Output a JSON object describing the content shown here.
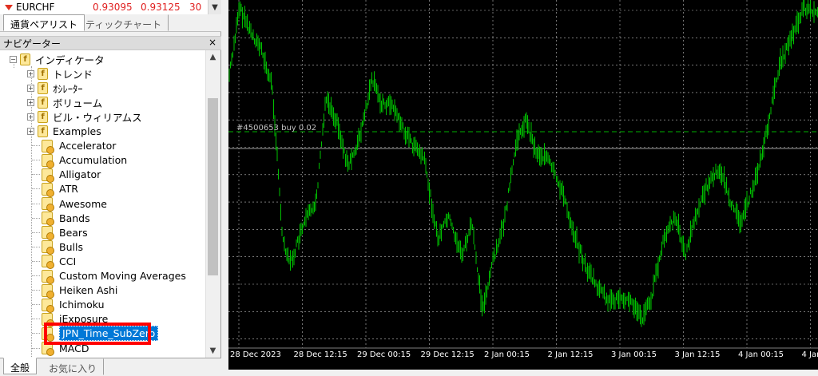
{
  "market_watch": {
    "symbol": "EURCHF",
    "bid": "0.93095",
    "ask": "0.93125",
    "spread": "30"
  },
  "top_tabs": [
    "通貨ペアリスト",
    "ティックチャート"
  ],
  "navigator": {
    "title": "ナビゲーター",
    "close_symbol": "×",
    "root": "インディケータ",
    "folders": [
      "トレンド",
      "ｵｼﾚｰﾀｰ",
      "ボリューム",
      "ビル・ウィリアムス",
      "Examples"
    ],
    "items": [
      "Accelerator",
      "Accumulation",
      "Alligator",
      "ATR",
      "Awesome",
      "Bands",
      "Bears",
      "Bulls",
      "CCI",
      "Custom Moving Averages",
      "Heiken Ashi",
      "Ichimoku",
      "iExposure",
      "JPN_Time_SubZero",
      "MACD"
    ],
    "selected_item": "JPN_Time_SubZero"
  },
  "bottom_tabs": [
    "全般",
    "お気に入り"
  ],
  "chart": {
    "order_label": "#4500653 buy 0.02",
    "time_labels": [
      "28 Dec 2023",
      "28 Dec 12:15",
      "29 Dec 00:15",
      "29 Dec 12:15",
      "2 Jan 00:15",
      "2 Jan 12:15",
      "3 Jan 00:15",
      "3 Jan 12:15",
      "4 Jan 00:15",
      "4 Jan"
    ],
    "bar_color": "#00c000",
    "background_color": "#000000",
    "grid_color": "#c0c0c0"
  }
}
